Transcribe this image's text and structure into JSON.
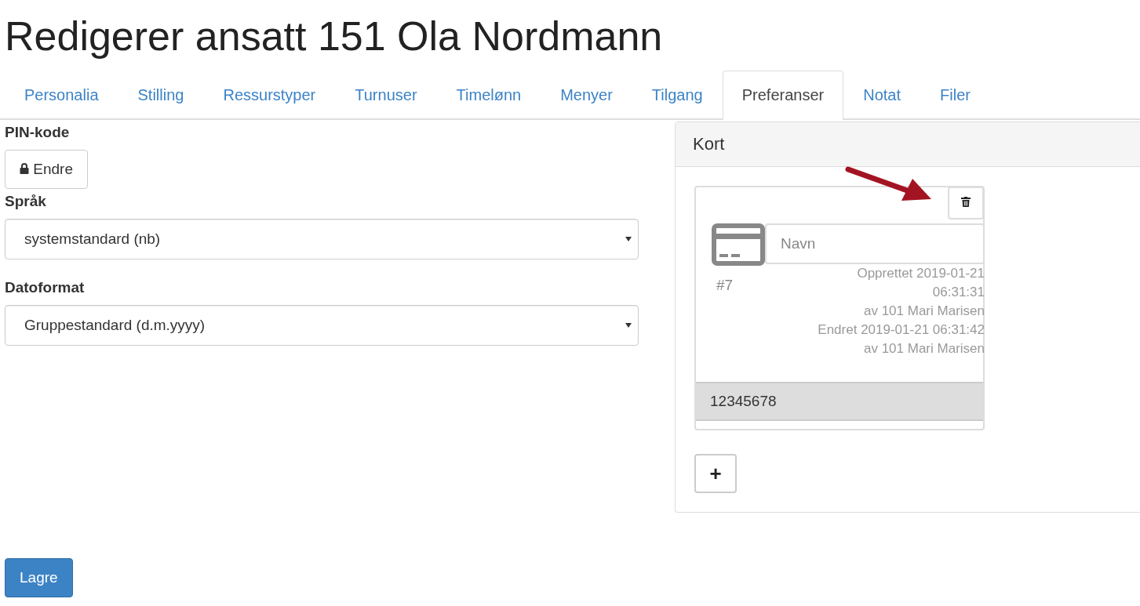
{
  "title": "Redigerer ansatt 151 Ola Nordmann",
  "tabs": [
    {
      "label": "Personalia",
      "selected": false
    },
    {
      "label": "Stilling",
      "selected": false
    },
    {
      "label": "Ressurstyper",
      "selected": false
    },
    {
      "label": "Turnuser",
      "selected": false
    },
    {
      "label": "Timelønn",
      "selected": false
    },
    {
      "label": "Menyer",
      "selected": false
    },
    {
      "label": "Tilgang",
      "selected": false
    },
    {
      "label": "Preferanser",
      "selected": true
    },
    {
      "label": "Notat",
      "selected": false
    },
    {
      "label": "Filer",
      "selected": false
    }
  ],
  "pin": {
    "label": "PIN-kode",
    "button": "Endre"
  },
  "fields": [
    {
      "label": "Språk",
      "value": "systemstandard (nb)"
    },
    {
      "label": "Datoformat",
      "value": "Gruppestandard (d.m.yyyy)"
    }
  ],
  "cards_panel": {
    "heading": "Kort",
    "cards": [
      {
        "number": "#7",
        "name_placeholder": "Navn",
        "meta": [
          "Opprettet 2019-01-21",
          "06:31:31",
          "av 101 Mari Marisen",
          "Endret 2019-01-21 06:31:42",
          "av 101 Mari Marisen"
        ],
        "code": "12345678"
      }
    ],
    "add_button": "+"
  },
  "save_button": "Lagre"
}
